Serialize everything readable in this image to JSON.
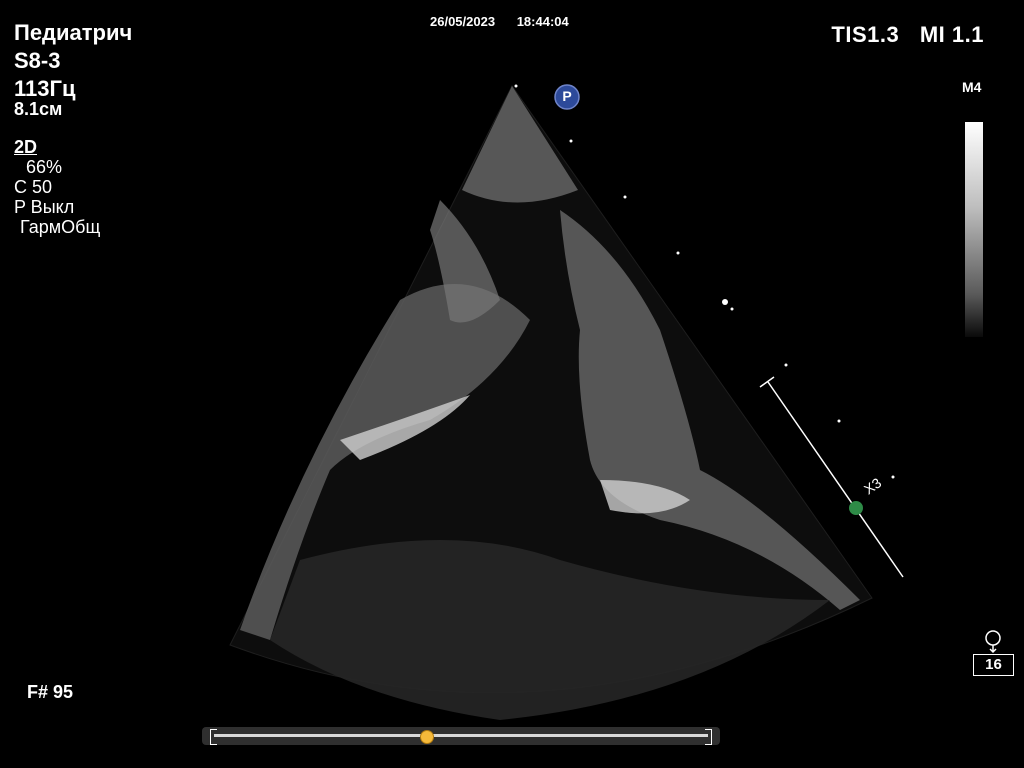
{
  "header": {
    "preset": "Педиатрич",
    "probe": "S8-3",
    "frame_rate": "113Гц",
    "depth": "8.1см",
    "date": "26/05/2023",
    "time": "18:44:04",
    "tis": "TIS1.3",
    "mi": "MI 1.1"
  },
  "params": {
    "mode": "2D",
    "gain": "66%",
    "compression": "C 50",
    "persistence": "P Выкл",
    "harmonics": "ГармОбщ"
  },
  "map": {
    "label": "M4"
  },
  "focus_marker": {
    "label": "P"
  },
  "caliper": {
    "label": "X3"
  },
  "frame": {
    "label": "F# 95"
  },
  "loop": {
    "count": "16"
  },
  "cine": {
    "position": 0.43
  },
  "colors": {
    "focus_marker": "#2d4a9a",
    "caliper_dot": "#2e8b47",
    "cine_handle": "#f5b93a"
  }
}
